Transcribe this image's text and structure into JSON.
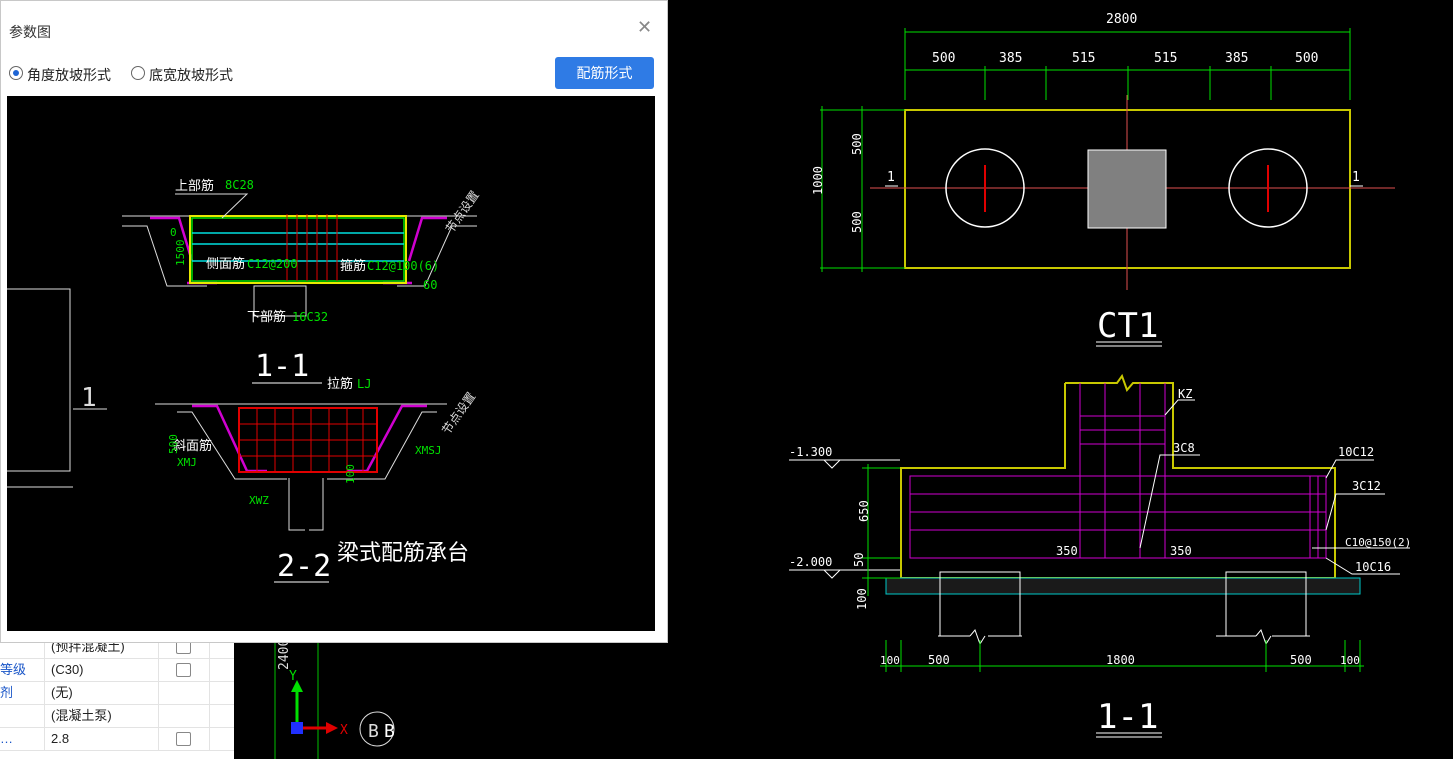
{
  "dialog": {
    "title": "参数图",
    "radio_angle": "角度放坡形式",
    "radio_bottom": "底宽放坡形式",
    "rebar_button": "配筋形式",
    "diagram": {
      "top_bar_label": "上部筋",
      "top_bar_value": "8C28",
      "zero": "0",
      "side_bar_label": "侧面筋",
      "side_bar_value": "C12@200",
      "stirrup_label": "箍筋",
      "stirrup_value": "C12@100(6)",
      "angle_value": "60",
      "bottom_bar_label": "下部筋",
      "bottom_bar_value": "16C32",
      "node_setting_1": "节点设置",
      "section_1_1": "1-1",
      "tie_bar_label": "拉筋",
      "tie_bar_value": "LJ",
      "node_setting_2": "节点设置",
      "slope_bar_label": "斜面筋",
      "xmj": "XMJ",
      "xmsj": "XMSJ",
      "xwz": "XWZ",
      "dim_500": "500",
      "dim_100": "100",
      "dim_1500": "1500",
      "section_2_2": "2-2",
      "caption": "梁式配筋承台",
      "left_label_1": "1"
    }
  },
  "prop_panel": {
    "rows": [
      {
        "key": "",
        "value": "(预拌混凝土)"
      },
      {
        "key": "等级",
        "value": "(C30)"
      },
      {
        "key": "剂",
        "value": "(无)"
      },
      {
        "key": "",
        "value": "(混凝土泵)"
      },
      {
        "key": "…",
        "value": "2.8"
      }
    ]
  },
  "cad": {
    "plan": {
      "total_width": "2800",
      "dims": [
        "500",
        "385",
        "515",
        "515",
        "385",
        "500"
      ],
      "height_total": "1000",
      "height_parts": [
        "500",
        "500"
      ],
      "cut_label": "1",
      "title": "CT1"
    },
    "section": {
      "kz": "KZ",
      "bar_3c8": "3C8",
      "bar_10c12": "10C12",
      "bar_3c12": "3C12",
      "stirrup": "C10@150(2)",
      "bar_10c16": "10C16",
      "elev_top": "-1.300",
      "elev_bottom": "-2.000",
      "dim_650": "650",
      "dim_50": "50",
      "dim_100": "100",
      "dim_350a": "350",
      "dim_350b": "350",
      "bottom_dims": [
        "100",
        "500",
        "1800",
        "500",
        "100"
      ],
      "title": "1-1"
    },
    "canvas": {
      "axis_dim": "2400",
      "axis_y": "Y",
      "axis_x": "X",
      "grid_b": "B"
    }
  }
}
